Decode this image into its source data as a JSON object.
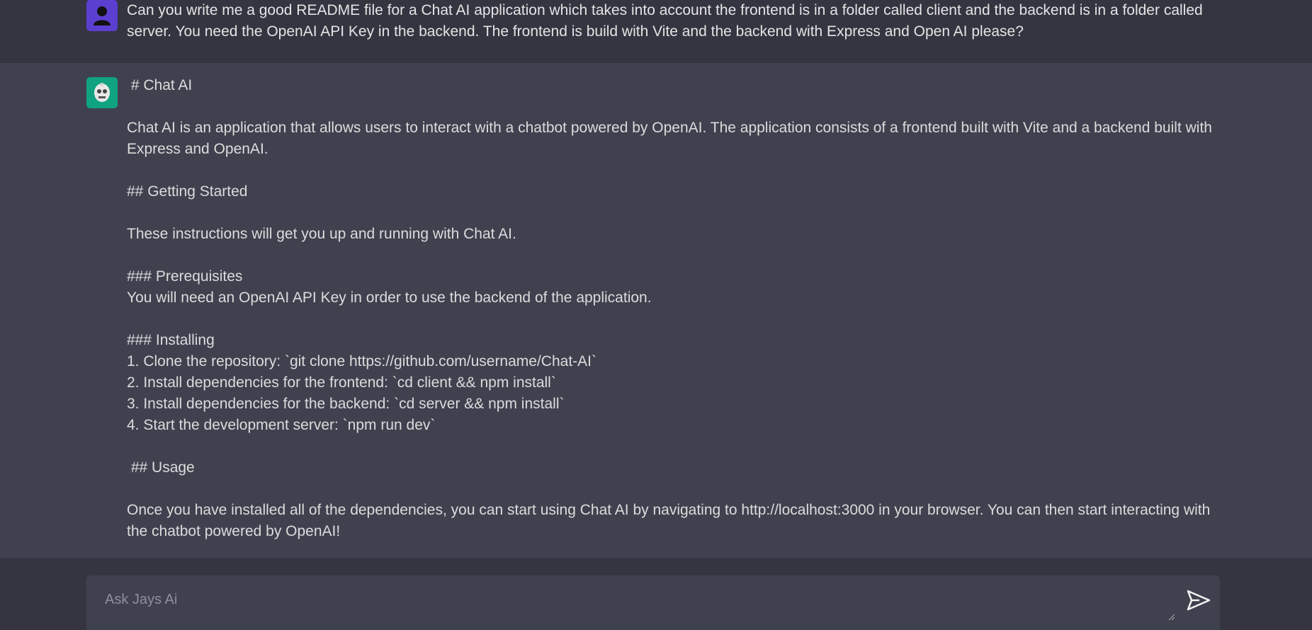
{
  "user_message": {
    "avatar_icon": "user-icon",
    "text": "Can you write me a good README file for a Chat AI application which takes into account the frontend is in a folder called client and the backend is in a folder called server. You need the OpenAI API Key in the backend. The frontend is build with Vite and the backend with Express and Open AI please?"
  },
  "ai_message": {
    "avatar_icon": "bot-icon",
    "lines": {
      "h1": " # Chat AI",
      "intro": "Chat AI is an application that allows users to interact with a chatbot powered by OpenAI. The application consists of a frontend built with Vite and a backend built with Express and OpenAI.",
      "h2_getting_started": "## Getting Started",
      "getting_started_text": "These instructions will get you up and running with Chat AI.",
      "h3_prereq": "### Prerequisites",
      "prereq_text": "You will need an OpenAI API Key in order to use the backend of the application.",
      "h3_installing": "### Installing",
      "step1": "1. Clone the repository: `git clone https://github.com/username/Chat-AI`",
      "step2": "2. Install dependencies for the frontend: `cd client && npm install`",
      "step3": "3. Install dependencies for the backend: `cd server && npm install`",
      "step4": "4. Start the development server: `npm run dev`",
      "h2_usage": " ## Usage",
      "usage_text": " Once you have installed all of the dependencies, you can start using Chat AI by navigating to http://localhost:3000 in your browser. You can then start interacting with the chatbot powered by OpenAI!"
    }
  },
  "composer": {
    "placeholder": "Ask Jays Ai",
    "value": "",
    "send_icon": "send-icon"
  },
  "colors": {
    "page_bg": "#343541",
    "ai_bg": "#40414f",
    "user_avatar": "#5b3fd1",
    "ai_avatar": "#10a37f"
  }
}
